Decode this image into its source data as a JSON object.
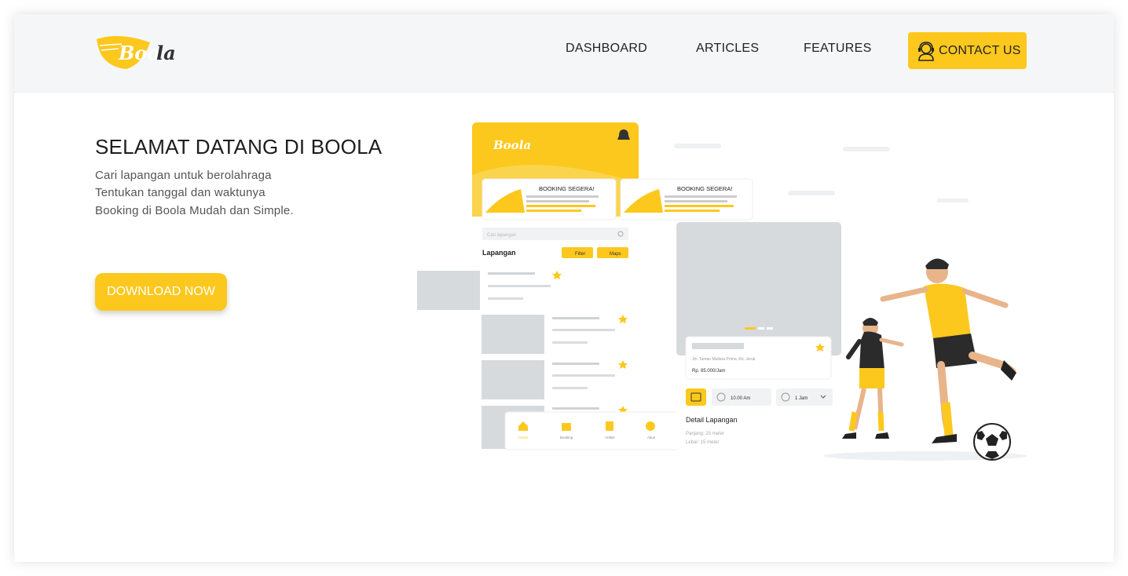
{
  "brand": {
    "logo_text": "Boola",
    "accent": "#fcc81e"
  },
  "nav": {
    "items": [
      {
        "label": "DASHBOARD"
      },
      {
        "label": "ARTICLES"
      },
      {
        "label": "FEATURES"
      }
    ],
    "contact_label": "CONTACT US",
    "contact_icon": "support-agent-icon"
  },
  "hero": {
    "title": "SELAMAT DATANG DI BOOLA",
    "lines": [
      "Cari lapangan untuk berolahraga",
      "Tentukan tanggal dan waktunya",
      "Booking di Boola Mudah dan Simple."
    ],
    "download_label": "DOWNLOAD NOW"
  },
  "mockup": {
    "app_logo": "Boola",
    "card_title": "BOOKING SEGERA!",
    "search_placeholder": "Cari lapangan",
    "section_title": "Lapangan",
    "filter_label": "Filter",
    "maps_label": "Maps",
    "bottom_nav": [
      "Home",
      "Booking",
      "Artikel",
      "Akun"
    ],
    "address": "Jln. Taman Mutiara Prima, Kb. Jeruk",
    "price": "Rp. 85.000/Jam",
    "time": "10.00 Am",
    "duration": "1 Jam",
    "detail_title": "Detail Lapangan",
    "detail_lines": [
      "Panjang: 25 meter",
      "Lebar: 15 meter"
    ]
  }
}
